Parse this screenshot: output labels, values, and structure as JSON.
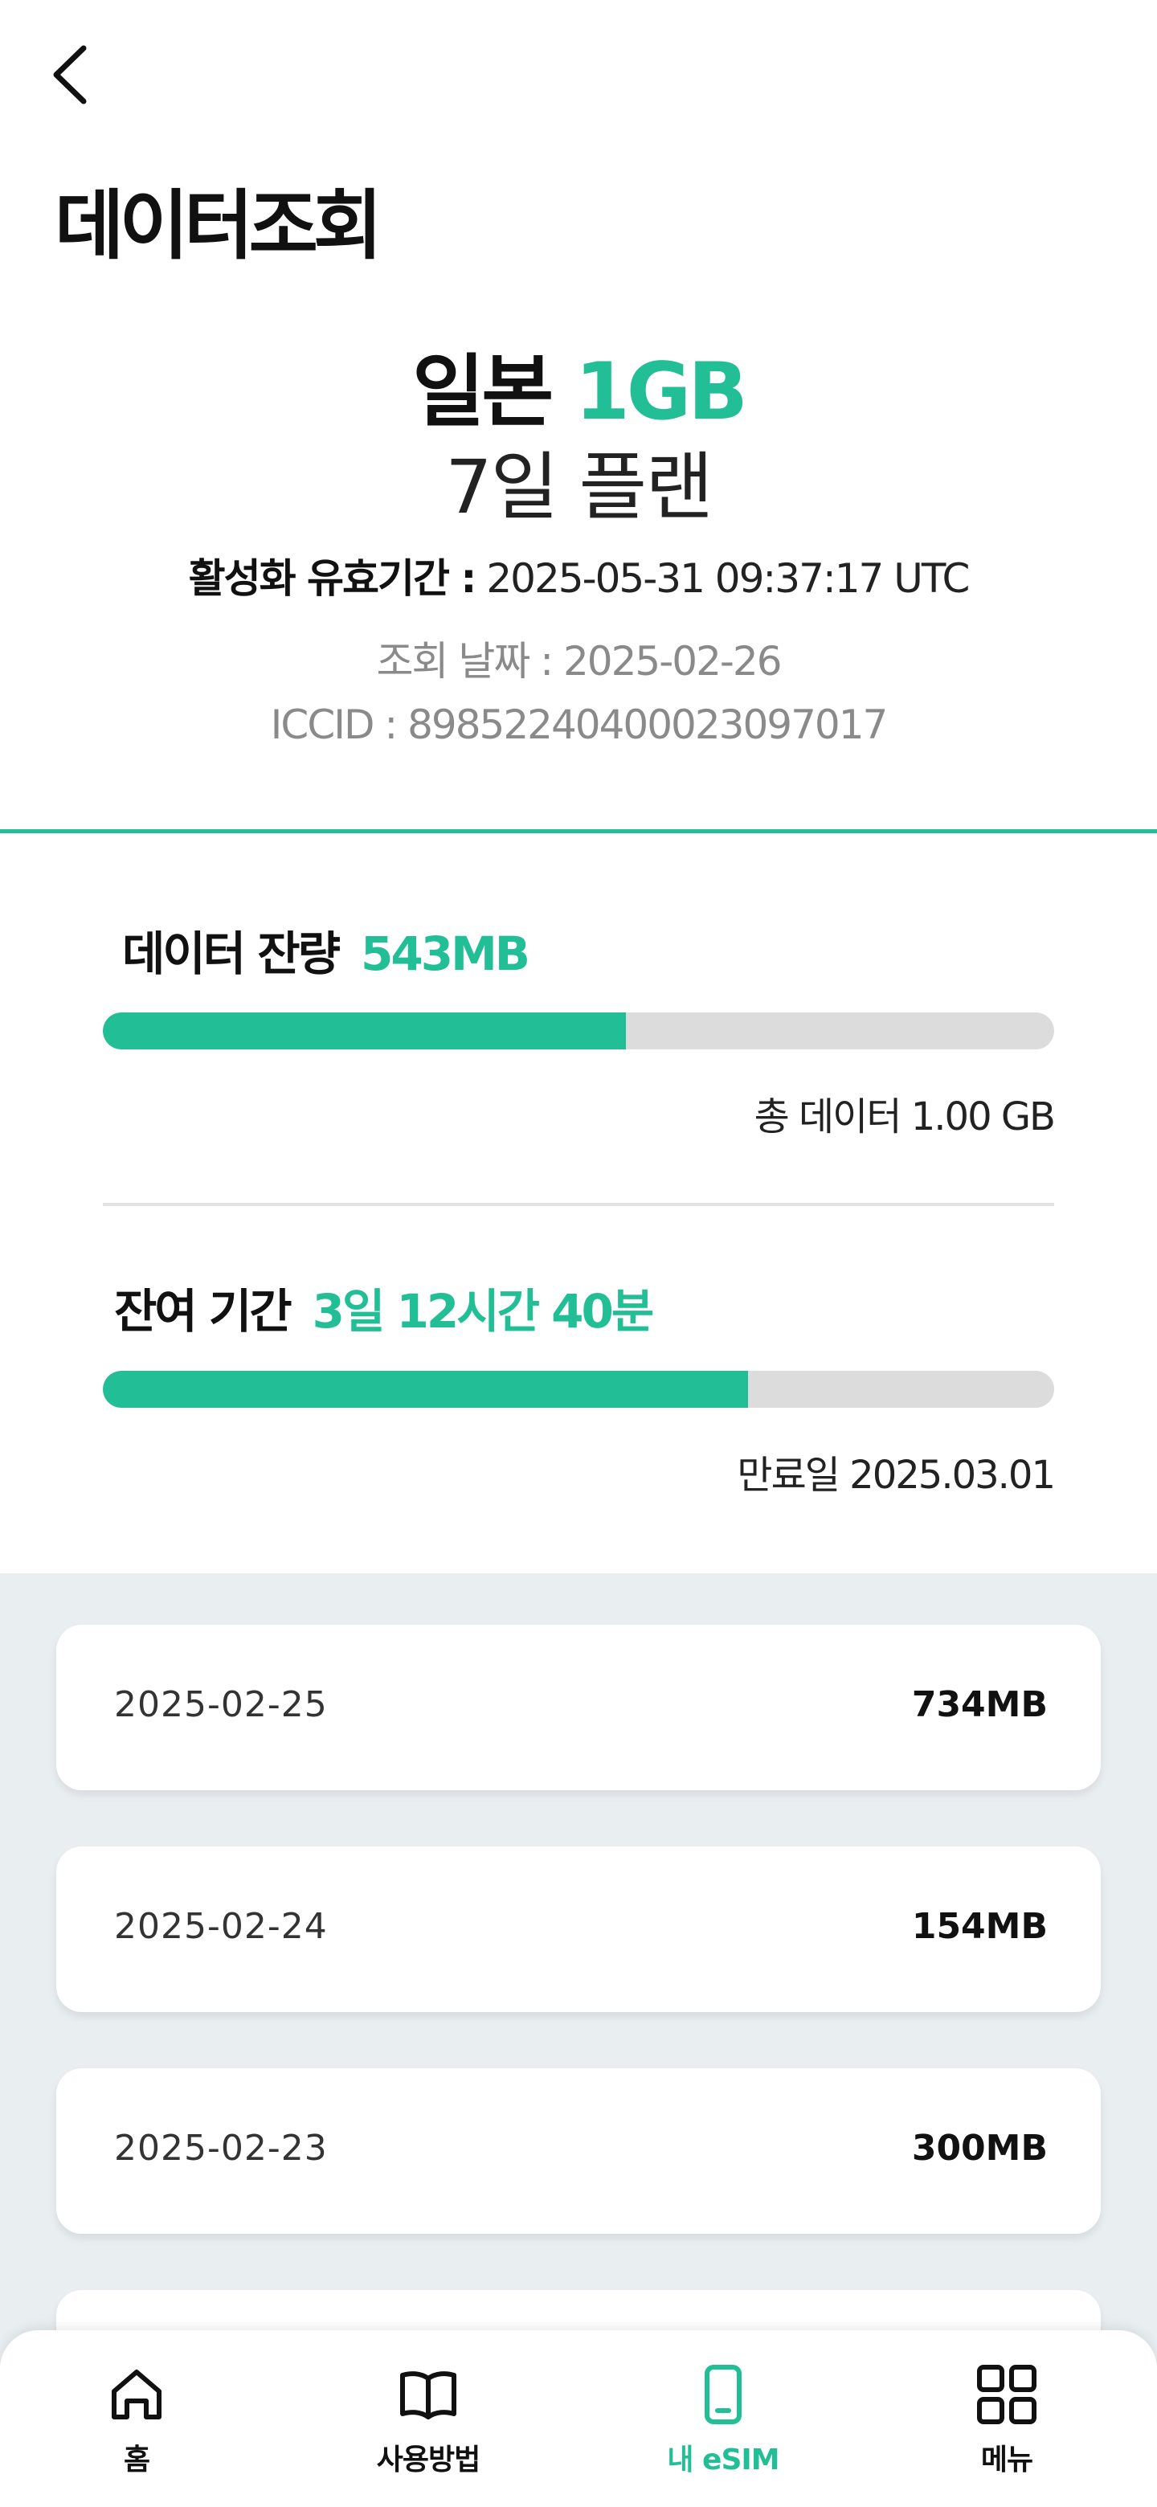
{
  "header": {
    "title": "데이터조회"
  },
  "plan": {
    "country": "일본",
    "data_amount": "1GB",
    "duration": "7일 플랜",
    "valid_label": "활성화 유효기간 :",
    "valid_value": "2025-05-31 09:37:17 UTC",
    "query_date": "조회 날짜 : 2025-02-26",
    "iccid": "ICCID : 89852240400023097017"
  },
  "remaining_data": {
    "label": "데이터 잔량",
    "value": "543MB",
    "fill_fraction": 0.55,
    "total": "총 데이터 1.00 GB"
  },
  "remaining_time": {
    "label": "잔여 기간",
    "value": "3일 12시간 40분",
    "fill_fraction": 0.678,
    "expiry": "만료일 2025.03.01"
  },
  "history": [
    {
      "date": "2025-02-25",
      "usage": "734MB"
    },
    {
      "date": "2025-02-24",
      "usage": "154MB"
    },
    {
      "date": "2025-02-23",
      "usage": "300MB"
    }
  ],
  "tabbar": {
    "home": "홈",
    "guide": "사용방법",
    "my_esim": "내 eSIM",
    "menu": "메뉴"
  },
  "colors": {
    "accent": "#22bf96",
    "history_bg": "#e9eef1",
    "track": "#dcdcdc"
  }
}
